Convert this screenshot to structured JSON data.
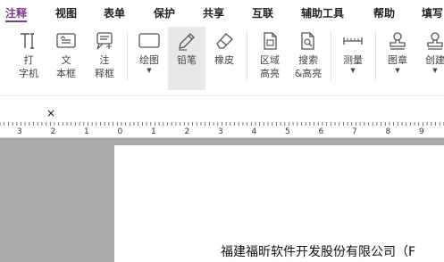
{
  "menu": {
    "tabs": [
      "注释",
      "视图",
      "表单",
      "保护",
      "共享",
      "互联",
      "辅助工具",
      "帮助",
      "填写"
    ],
    "active_index": 0
  },
  "ribbon": {
    "typewriter": "打\n字机",
    "textbox": "文\n本框",
    "callout": "注\n释框",
    "drawing": "绘图",
    "pencil": "铅笔",
    "eraser": "橡皮",
    "area_highlight": "区域\n高亮",
    "search_highlight": "搜索\n&高亮",
    "measure": "测量",
    "stamp": "图章",
    "create": "创建"
  },
  "doc_tab": {
    "close_glyph": "×"
  },
  "ruler": {
    "labels": [
      "3",
      "2",
      "1",
      "0",
      "1",
      "2",
      "3",
      "4",
      "5",
      "6",
      "7",
      "8",
      "9"
    ]
  },
  "page": {
    "text": "福建福昕软件开发股份有限公司（F"
  },
  "colors": {
    "accent": "#7b3a8c",
    "canvas": "#ababab"
  }
}
